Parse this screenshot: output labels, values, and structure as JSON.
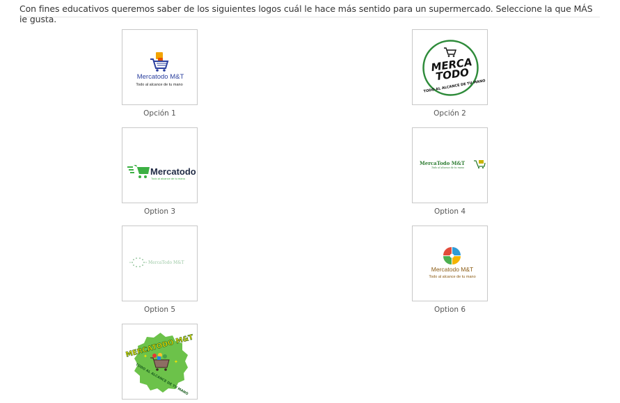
{
  "question": {
    "text": "Con fines educativos queremos saber de los siguientes logos cuál le hace más sentido para un supermercado. Seleccione la que MÁS le gusta."
  },
  "options": [
    {
      "caption": "Opción 1",
      "logo_text": "Mercatodo M&T",
      "logo_tagline": "Todo al alcance de tu mano",
      "icon": "shopping-cart-icon",
      "colors": {
        "primary": "#2a3f9e",
        "accent": "#f2a300"
      }
    },
    {
      "caption": "Opción 2",
      "logo_text_line1": "MERCA",
      "logo_text_line2": "TODO",
      "logo_tagline": "TODO AL ALCANCE DE TU MANO",
      "icon": "shopping-cart-icon",
      "colors": {
        "ring": "#2e8b3a",
        "text": "#111111"
      }
    },
    {
      "caption": "Option 3",
      "logo_text": "Mercatodo",
      "logo_tagline": "Todo al alcance de tu mano",
      "icon": "fast-cart-icon",
      "colors": {
        "primary": "#3cb043",
        "text": "#1f2a44"
      }
    },
    {
      "caption": "Option 4",
      "logo_text": "MercaTodo M&T",
      "logo_tagline": "Todo al alcance de tu mano",
      "icon": "shopping-cart-icon",
      "colors": {
        "primary": "#2e7d32",
        "accent": "#c8b400"
      }
    },
    {
      "caption": "Option 5",
      "logo_text": "MercaTodo M&T",
      "icon": "dotted-circle-icon",
      "colors": {
        "primary": "#9cc9a5"
      }
    },
    {
      "caption": "Option 6",
      "logo_text": "Mercatodo M&T",
      "logo_tagline": "Todo al alcance de tu mano",
      "icon": "four-petal-icon",
      "colors": {
        "text": "#8a5a12",
        "red": "#e24b3b",
        "blue": "#2f9bd6",
        "green": "#4caf50",
        "yellow": "#f4b400"
      }
    },
    {
      "caption": "",
      "logo_text": "MERCATODO M&T",
      "logo_tagline": "TODO AL ALCANCE DE TU MANO",
      "icon": "grocery-cart-badge-icon",
      "colors": {
        "badge": "#6cc24a",
        "text_fill": "#f5e400",
        "text_stroke": "#1b5e20"
      }
    }
  ]
}
